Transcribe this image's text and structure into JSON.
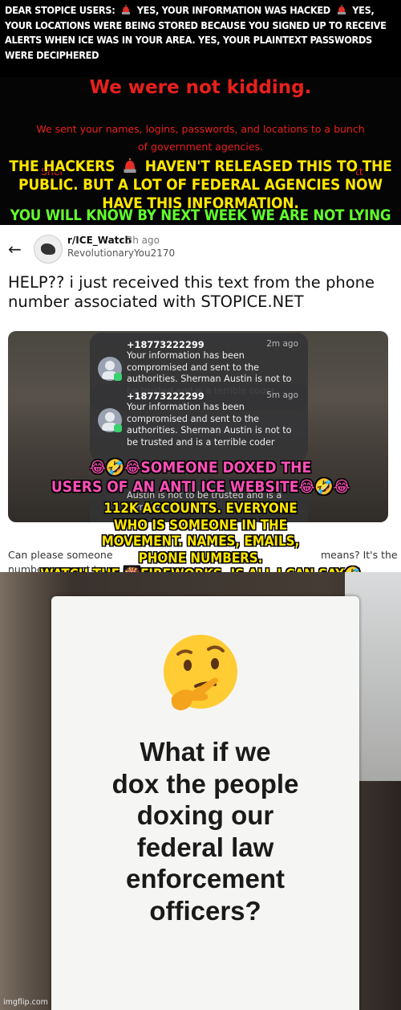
{
  "top_panel": {
    "caption_white": [
      "DEAR STOPICE USERS:",
      "YES, YOUR INFORMATION WAS HACKED",
      "YES, YOUR LOCATIONS WERE BEING STORED BECAUSE YOU SIGNED UP TO RECEIVE ALERTS WHEN ICE WAS IN YOUR AREA. YES, YOUR PLAINTEXT PASSWORDS WERE DECIPHERED"
    ],
    "site_heading": "We were not kidding.",
    "site_body": "We sent your names, logins, passwords, and locations to a bunch of government agencies.",
    "site_fragment_left": "Sher",
    "site_fragment_right": "tt",
    "caption_yellow": [
      "THE HACKERS",
      "HAVEN'T RELEASED THIS TO THE PUBLIC. BUT A LOT OF FEDERAL AGENCIES NOW HAVE THIS INFORMATION."
    ]
  },
  "middle_panel": {
    "caption_green": "YOU WILL KNOW BY NEXT WEEK WE ARE NOT LYING",
    "back_icon": "arrow-left-icon",
    "subreddit": "r/ICE_Watch",
    "post_age": "· 3h ago",
    "username": "RevolutionaryYou2170",
    "post_title": "HELP?? i just received this text from the phone number associated with STOPICE.NET",
    "notifications": [
      {
        "sender": "+18773222299",
        "time": "2m ago",
        "text": "Your information has been compromised and sent to the authorities. Sherman Austin is not to be trusted and is a terrible coder"
      },
      {
        "sender": "+18773222299",
        "time": "5m ago",
        "text": "Your information has been compromised and sent to the authorities. Sherman Austin is not to be trusted and is a terrible coder"
      },
      {
        "sender": "+18773222299",
        "time": "",
        "text": "Austin is not to be trusted and is a terrible"
      }
    ],
    "post_footer": [
      "Can please someone",
      "means? It's the",
      "number connect t"
    ],
    "caption_pink": [
      "😂🤣😂SOMEONE DOXED THE",
      "USERS OF AN ANTI ICE WEBSITE😂🤣😂"
    ],
    "caption_yellow": [
      "112K ACCOUNTS. EVERYONE",
      "WHO IS SOMEONE IN THE",
      "MOVEMENT. NAMES, EMAILS,",
      "PHONE NUMBERS.",
      "WATCH THE 🎇FIREWORKS, IS ALL I CAN SAY🤣"
    ]
  },
  "bottom_panel": {
    "emoji": "🤔",
    "sign_text": [
      "What if we",
      "dox the people",
      "doxing our",
      "federal law",
      "enforcement",
      "officers?"
    ],
    "watermark": "imgflip.com"
  },
  "colors": {
    "red": "#e8201c",
    "yellow": "#ffe600",
    "green": "#62ff2e",
    "pink": "#ff4fb8"
  }
}
